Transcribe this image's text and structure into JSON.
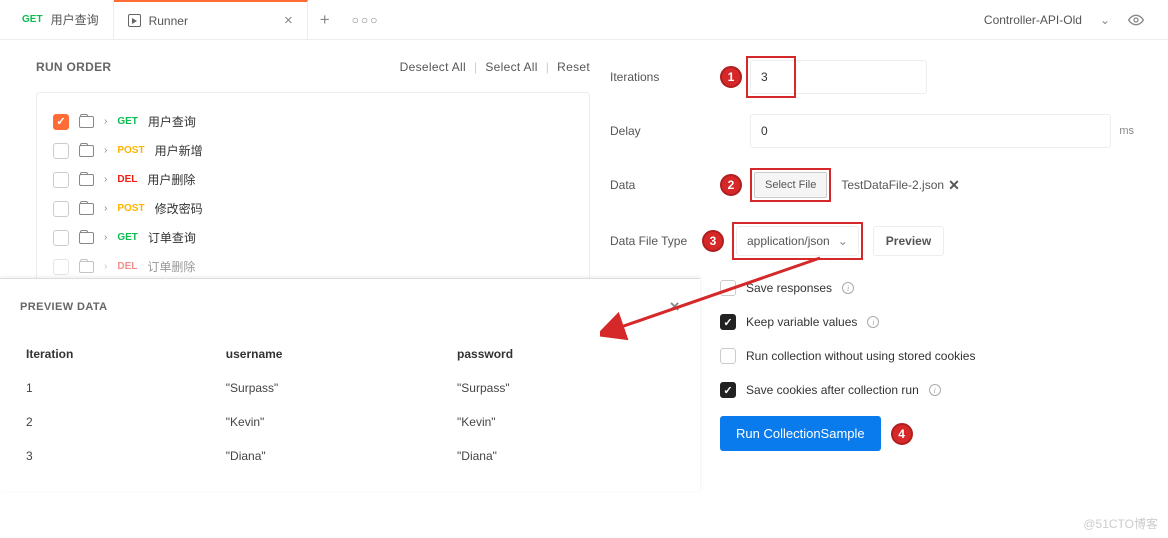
{
  "env": {
    "name": "Controller-API-Old"
  },
  "tabs": [
    {
      "method": "GET",
      "label": "用户查询"
    },
    {
      "label": "Runner"
    }
  ],
  "run_order": {
    "title": "RUN ORDER",
    "deselect": "Deselect All",
    "select": "Select All",
    "reset": "Reset",
    "items": [
      {
        "method": "GET",
        "method_class": "m-get",
        "label": "用户查询",
        "checked": true
      },
      {
        "method": "POST",
        "method_class": "m-post",
        "label": "用户新增",
        "checked": false
      },
      {
        "method": "DEL",
        "method_class": "m-del",
        "label": "用户删除",
        "checked": false
      },
      {
        "method": "POST",
        "method_class": "m-post",
        "label": "修改密码",
        "checked": false
      },
      {
        "method": "GET",
        "method_class": "m-get",
        "label": "订单查询",
        "checked": false
      },
      {
        "method": "DEL",
        "method_class": "m-del",
        "label": "订单删除",
        "checked": false
      }
    ]
  },
  "settings": {
    "iterations_label": "Iterations",
    "iterations_value": "3",
    "delay_label": "Delay",
    "delay_value": "0",
    "delay_unit": "ms",
    "data_label": "Data",
    "select_file_btn": "Select File",
    "data_file_name": "TestDataFile-2.json",
    "data_file_type_label": "Data File Type",
    "data_file_type_value": "application/json",
    "preview_btn": "Preview",
    "opt_save_responses": "Save responses",
    "opt_keep_vars": "Keep variable values",
    "opt_no_cookies": "Run collection without using stored cookies",
    "opt_save_cookies": "Save cookies after collection run",
    "run_btn": "Run CollectionSample"
  },
  "badges": {
    "b1": "1",
    "b2": "2",
    "b3": "3",
    "b4": "4"
  },
  "preview": {
    "title": "PREVIEW DATA",
    "headers": {
      "c1": "Iteration",
      "c2": "username",
      "c3": "password"
    },
    "rows": [
      {
        "iter": "1",
        "user": "\"Surpass\"",
        "pass": "\"Surpass\""
      },
      {
        "iter": "2",
        "user": "\"Kevin\"",
        "pass": "\"Kevin\""
      },
      {
        "iter": "3",
        "user": "\"Diana\"",
        "pass": "\"Diana\""
      }
    ]
  },
  "watermark": "@51CTO博客"
}
